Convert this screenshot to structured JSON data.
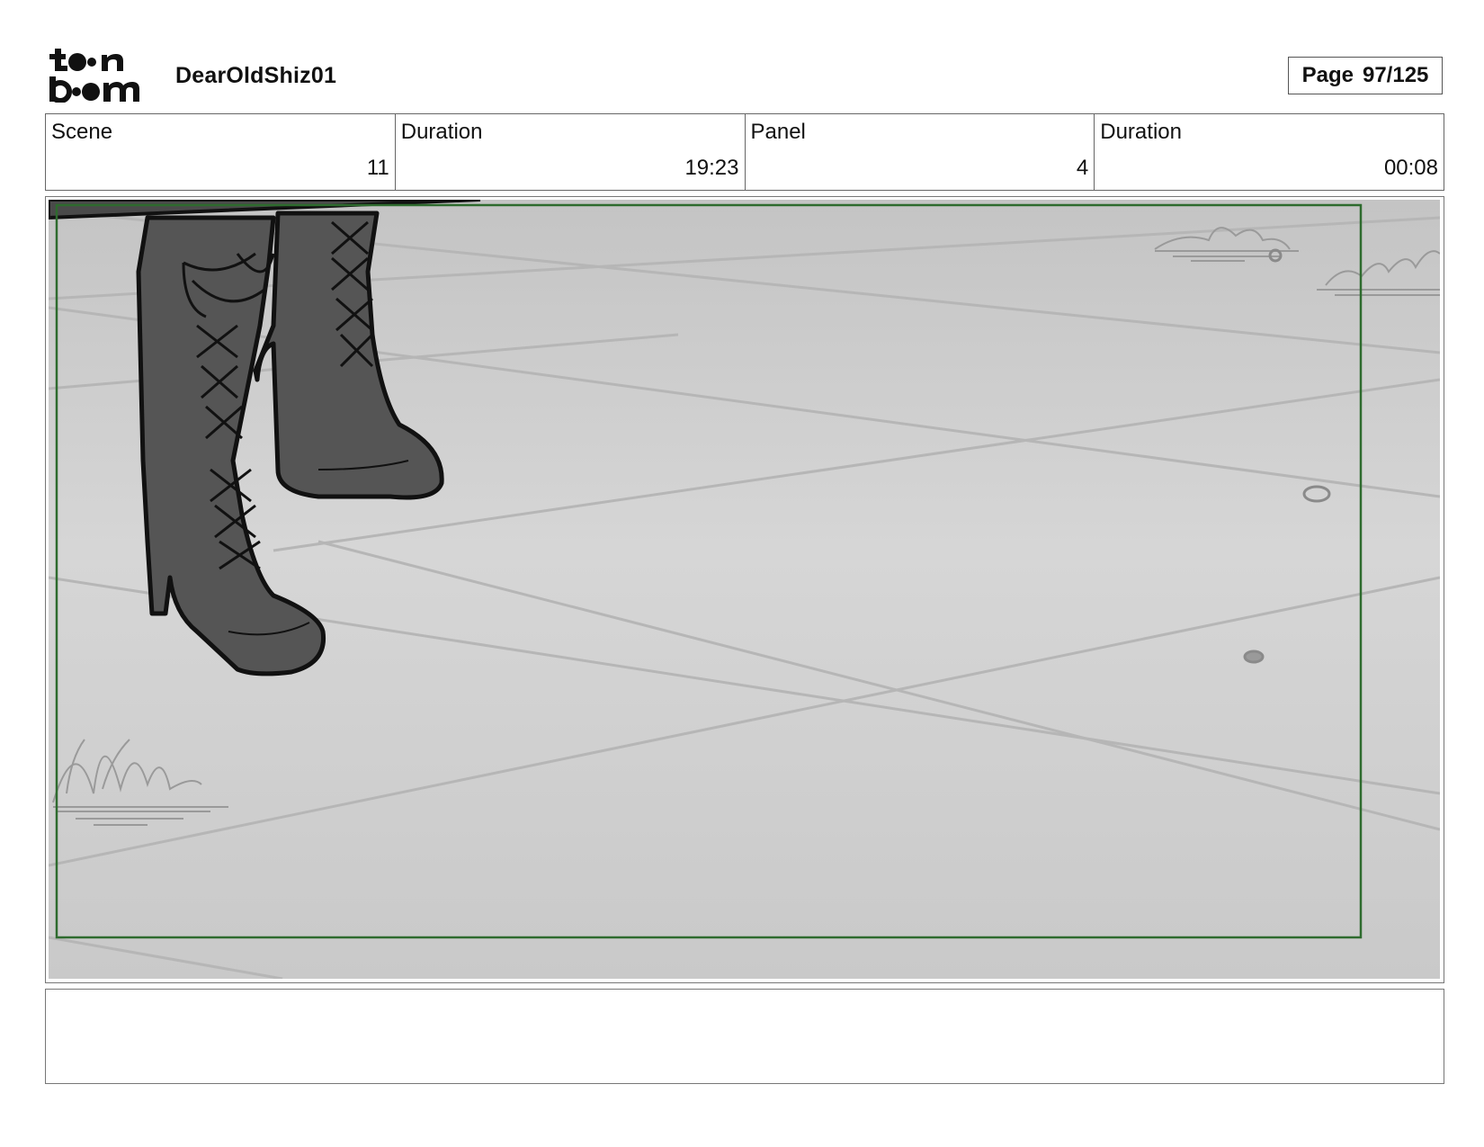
{
  "header": {
    "logo_name": "toon boom logo",
    "project_title": "DearOldShiz01",
    "page_label": "Page",
    "page_number": "97/125"
  },
  "info": {
    "scene_label": "Scene",
    "scene_value": "11",
    "scene_duration_label": "Duration",
    "scene_duration_value": "19:23",
    "panel_label": "Panel",
    "panel_value": "4",
    "panel_duration_label": "Duration",
    "panel_duration_value": "00:08"
  },
  "panel": {
    "description": "",
    "safe_frame_color": "#2e6b2e",
    "floor_color": "#d3d3d3",
    "boot_color": "#555555"
  },
  "notes": {
    "text": ""
  }
}
